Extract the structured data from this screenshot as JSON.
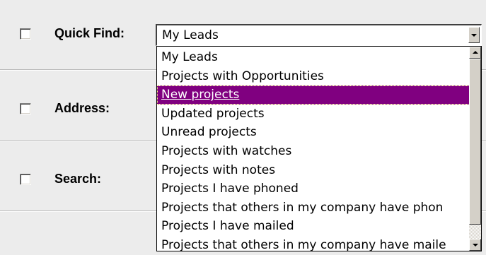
{
  "filters": [
    {
      "label": "Quick Find:",
      "checked": false
    },
    {
      "label": "Address:",
      "checked": false
    },
    {
      "label": "Search:",
      "checked": false
    }
  ],
  "quick_find": {
    "selected_value": "My Leads",
    "options": [
      "My Leads",
      "Projects with Opportunities",
      "New projects",
      "Updated projects",
      "Unread projects",
      "Projects with watches",
      "Projects with notes",
      "Projects I have phoned",
      "Projects that others in my company have phon",
      "Projects I have mailed",
      "Projects that others in my company have maile"
    ],
    "highlighted_option": "New projects"
  },
  "colors": {
    "highlight": "#800080",
    "background": "#ececec"
  }
}
